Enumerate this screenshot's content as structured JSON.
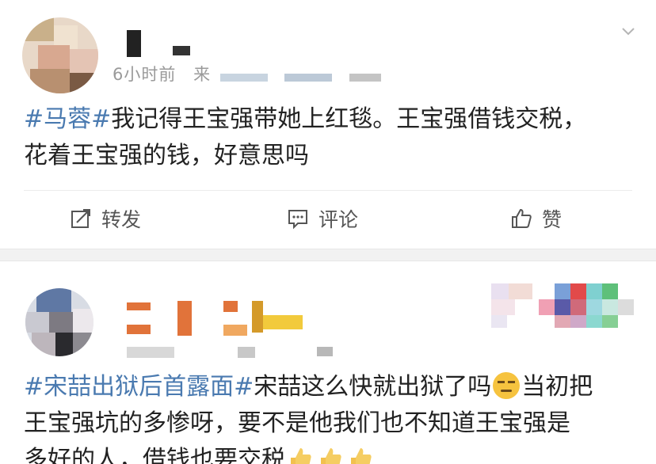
{
  "post1": {
    "meta_time": "6小时前",
    "meta_source": "来",
    "hashtag": "#马蓉#",
    "text_line1": "我记得王宝强带她上红毯。王宝强借钱交税，",
    "text_line2": "花着王宝强的钱，好意思吗",
    "actions": {
      "repost": "转发",
      "comment": "评论",
      "like": "赞"
    }
  },
  "post2": {
    "hashtag": "#宋喆出狱后首露面#",
    "text_line1_after": "宋喆这么快就出狱了吗",
    "text_line1_end": "当初把",
    "text_line2": "王宝强坑的多惨呀，要不是他我们也不知道王宝强是",
    "text_line3": "多好的人，借钱也要交税"
  },
  "colors": {
    "hashtag": "#4a7ab0",
    "text": "#222222",
    "meta": "#9a9a9a",
    "separator": "#f2f2f2"
  },
  "icons": [
    "chevron-down-icon",
    "repost-icon",
    "comment-icon",
    "like-icon",
    "smirk-emoji-icon",
    "thumbs-up-icon"
  ]
}
